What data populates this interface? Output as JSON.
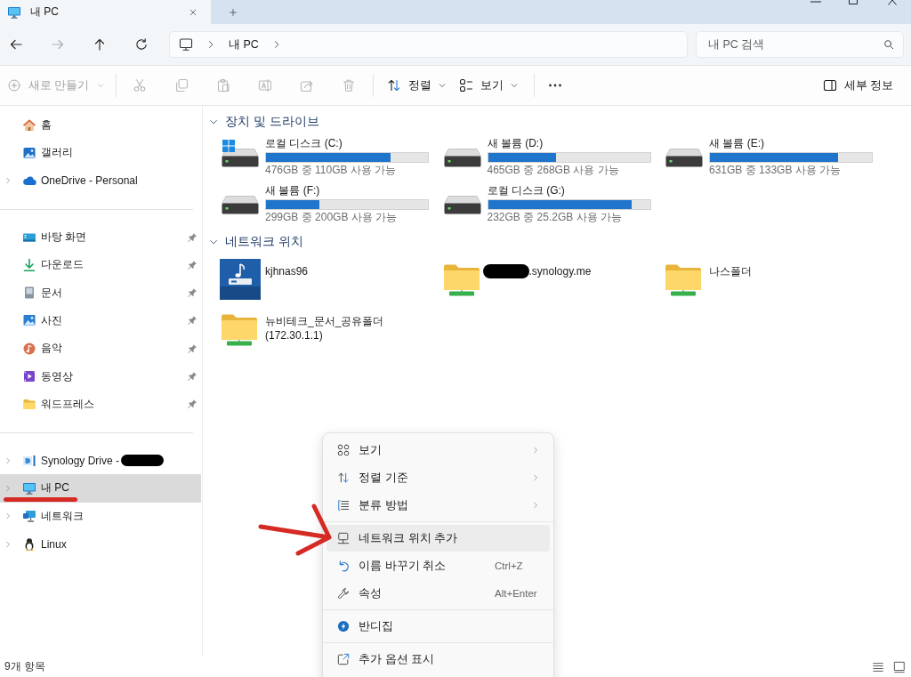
{
  "tabs": [
    {
      "title": "내 PC",
      "selected": true
    }
  ],
  "navigation": [
    {
      "kind": "back",
      "disabled": false
    },
    {
      "kind": "forward",
      "disabled": true
    },
    {
      "kind": "up",
      "disabled": false
    },
    {
      "kind": "refresh",
      "disabled": false
    }
  ],
  "address_bar": {
    "crumbs": [
      "내 PC"
    ]
  },
  "search": {
    "placeholder": "내 PC 검색"
  },
  "toolbar": {
    "new_button": {
      "label": "새로 만들기",
      "disabled": true
    },
    "actions": [
      {
        "kind": "cut",
        "disabled": true
      },
      {
        "kind": "copy",
        "disabled": true
      },
      {
        "kind": "paste",
        "disabled": true
      },
      {
        "kind": "rename",
        "disabled": true
      },
      {
        "kind": "share",
        "disabled": true
      },
      {
        "kind": "delete",
        "disabled": true
      }
    ],
    "menus": [
      {
        "kind": "sort",
        "label": "정렬"
      },
      {
        "kind": "view",
        "label": "보기"
      }
    ],
    "details": {
      "label": "세부 정보"
    }
  },
  "sidebar": {
    "groups": [
      {
        "items": [
          {
            "kind": "home",
            "label": "홈",
            "expandable": false,
            "pinned": false,
            "selected": false,
            "redacted": false,
            "underlined": false
          },
          {
            "kind": "gallery",
            "label": "갤러리",
            "expandable": false,
            "pinned": false,
            "selected": false,
            "redacted": false,
            "underlined": false
          },
          {
            "kind": "onedrive",
            "label": "OneDrive - Personal",
            "expandable": true,
            "pinned": false,
            "selected": false,
            "redacted": false,
            "underlined": false
          }
        ]
      },
      {
        "items": [
          {
            "kind": "desktop",
            "label": "바탕 화면",
            "expandable": false,
            "pinned": true,
            "selected": false,
            "redacted": false,
            "underlined": false
          },
          {
            "kind": "downloads",
            "label": "다운로드",
            "expandable": false,
            "pinned": true,
            "selected": false,
            "redacted": false,
            "underlined": false
          },
          {
            "kind": "documents",
            "label": "문서",
            "expandable": false,
            "pinned": true,
            "selected": false,
            "redacted": false,
            "underlined": false
          },
          {
            "kind": "pictures",
            "label": "사진",
            "expandable": false,
            "pinned": true,
            "selected": false,
            "redacted": false,
            "underlined": false
          },
          {
            "kind": "music",
            "label": "음악",
            "expandable": false,
            "pinned": true,
            "selected": false,
            "redacted": false,
            "underlined": false
          },
          {
            "kind": "videos",
            "label": "동영상",
            "expandable": false,
            "pinned": true,
            "selected": false,
            "redacted": false,
            "underlined": false
          },
          {
            "kind": "folder",
            "label": "워드프레스",
            "expandable": false,
            "pinned": true,
            "selected": false,
            "redacted": false,
            "underlined": false
          }
        ]
      },
      {
        "items": [
          {
            "kind": "synology-drive",
            "label": "Synology Drive -",
            "expandable": true,
            "pinned": false,
            "selected": false,
            "redacted": true,
            "underlined": false
          },
          {
            "kind": "pc",
            "label": "내 PC",
            "expandable": true,
            "pinned": false,
            "selected": true,
            "redacted": false,
            "underlined": true
          },
          {
            "kind": "network",
            "label": "네트워크",
            "expandable": true,
            "pinned": false,
            "selected": false,
            "redacted": false,
            "underlined": false
          },
          {
            "kind": "linux",
            "label": "Linux",
            "expandable": true,
            "pinned": false,
            "selected": false,
            "redacted": false,
            "underlined": false
          }
        ]
      }
    ]
  },
  "sections": [
    {
      "kind": "drives",
      "title": "장치 및 드라이브",
      "expanded": true,
      "items": [
        {
          "name": "로컬 디스크 (C:)",
          "system": true,
          "level": 0.77,
          "space": "476GB 중 110GB 사용 가능"
        },
        {
          "name": "새 볼륨 (D:)",
          "system": false,
          "level": 0.42,
          "space": "465GB 중 268GB 사용 가능"
        },
        {
          "name": "새 볼륨 (E:)",
          "system": false,
          "level": 0.79,
          "space": "631GB 중 133GB 사용 가능"
        },
        {
          "name": "새 볼륨 (F:)",
          "system": false,
          "level": 0.33,
          "space": "299GB 중 200GB 사용 가능"
        },
        {
          "name": "로컬 디스크 (G:)",
          "system": false,
          "level": 0.89,
          "space": "232GB 중 25.2GB 사용 가능"
        }
      ]
    },
    {
      "kind": "network",
      "title": "네트워크 위치",
      "expanded": true,
      "items": [
        {
          "kind": "nas",
          "name": "kjhnas96",
          "redacted": false
        },
        {
          "kind": "share",
          "name": ".synology.me",
          "redacted": true
        },
        {
          "kind": "share",
          "name": "나스폴더",
          "redacted": false
        },
        {
          "kind": "share",
          "name": "뉴비테크_문서_공유폴더",
          "address": "(172.30.1.1)",
          "redacted": false
        }
      ]
    }
  ],
  "context_menu": {
    "groups": [
      {
        "items": [
          {
            "kind": "view",
            "label": "보기",
            "submenu": true,
            "selected": false,
            "arrow_pointer": false
          },
          {
            "kind": "sort",
            "label": "정렬 기준",
            "submenu": true,
            "selected": false,
            "arrow_pointer": false
          },
          {
            "kind": "group",
            "label": "분류 방법",
            "submenu": true,
            "selected": false,
            "arrow_pointer": false
          }
        ]
      },
      {
        "items": [
          {
            "kind": "add-network-location",
            "label": "네트워크 위치 추가",
            "submenu": false,
            "selected": true,
            "arrow_pointer": true
          },
          {
            "kind": "undo",
            "label": "이름 바꾸기 취소",
            "shortcut": "Ctrl+Z",
            "submenu": false,
            "selected": false,
            "arrow_pointer": false
          },
          {
            "kind": "properties",
            "label": "속성",
            "shortcut": "Alt+Enter",
            "submenu": false,
            "selected": false,
            "arrow_pointer": false
          }
        ]
      },
      {
        "items": [
          {
            "kind": "bandizip",
            "label": "반디집",
            "submenu": false,
            "selected": false,
            "arrow_pointer": false
          }
        ]
      },
      {
        "items": [
          {
            "kind": "more-options",
            "label": "추가 옵션 표시",
            "submenu": false,
            "selected": false,
            "arrow_pointer": false
          }
        ]
      }
    ]
  },
  "status_bar": {
    "item_count": "9개 항목"
  }
}
